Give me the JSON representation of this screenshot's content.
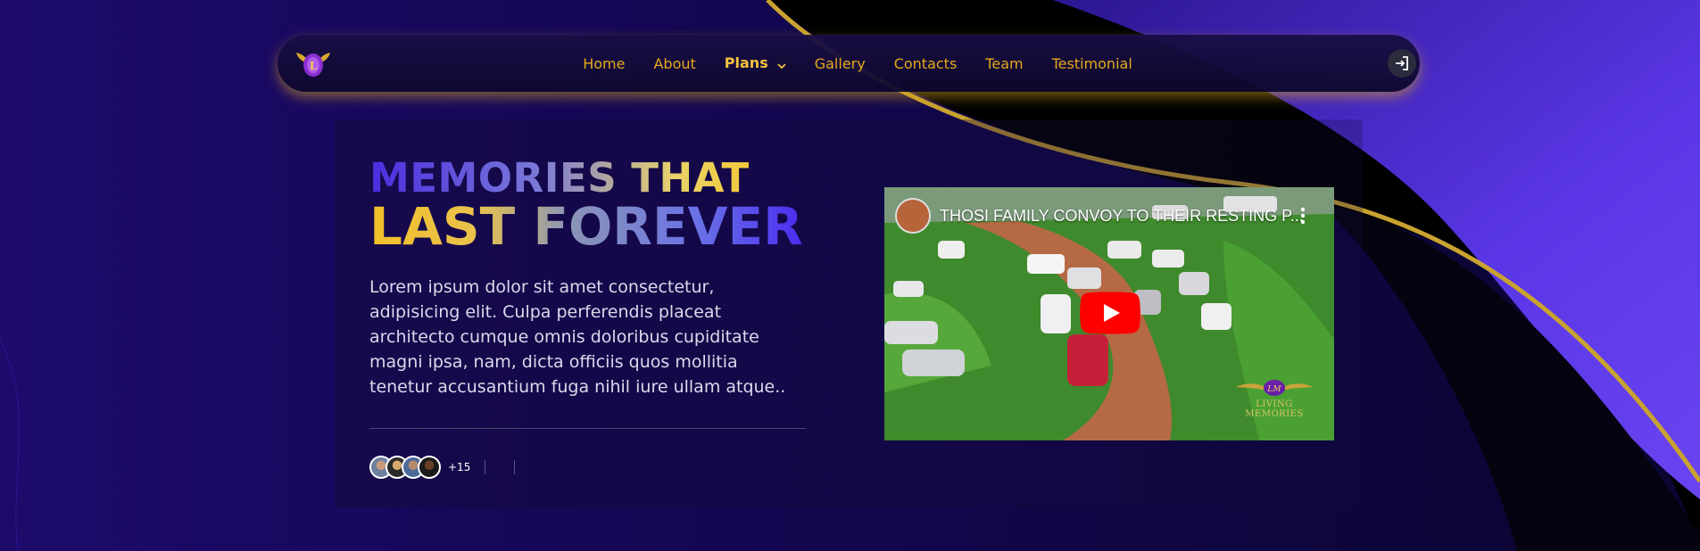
{
  "nav": {
    "links": [
      "Home",
      "About",
      "Plans",
      "Gallery",
      "Contacts",
      "Team",
      "Testimonial"
    ],
    "active_link": "Plans",
    "brand_icon": "winged-badge-logo",
    "login_icon": "login-icon"
  },
  "hero": {
    "title_line1": "MEMORIES THAT",
    "title_line2": "LAST FOREVER",
    "description": "Lorem ipsum dolor sit amet consectetur, adipisicing elit. Culpa perferendis placeat architecto cumque omnis doloribus cupiditate magni ipsa, nam, dicta officiis quos mollitia tenetur accusantium fuga nihil iure ullam atque..",
    "avatar_extra_count": "+15"
  },
  "video": {
    "title": "THOSI FAMILY CONVOY TO THEIR RESTING P...",
    "watermark": "LIVING MEMORIES",
    "watermark_monogram": "LM"
  },
  "colors": {
    "gold": "#e6a81e",
    "deep_purple": "#0b0633",
    "violet": "#5b3ae8",
    "youtube_red": "#ff0000"
  }
}
